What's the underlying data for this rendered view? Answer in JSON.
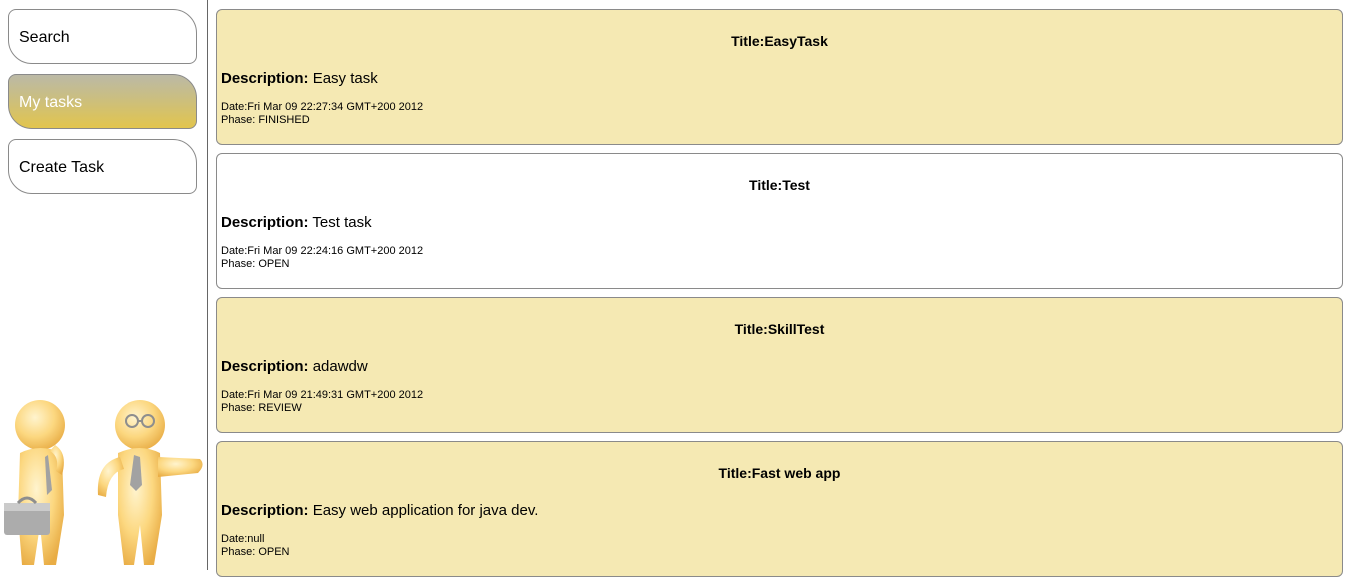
{
  "nav": {
    "search": "Search",
    "my_tasks": "My tasks",
    "create_task": "Create Task"
  },
  "labels": {
    "title_prefix": "Title:",
    "description": "Description:",
    "date_prefix": "Date:",
    "phase_prefix": "Phase: "
  },
  "tasks": [
    {
      "title": "EasyTask",
      "description": "Easy task",
      "date": "Fri Mar 09 22:27:34 GMT+200 2012",
      "phase": "FINISHED"
    },
    {
      "title": "Test",
      "description": "Test task",
      "date": "Fri Mar 09 22:24:16 GMT+200 2012",
      "phase": "OPEN"
    },
    {
      "title": "SkillTest",
      "description": "adawdw",
      "date": "Fri Mar 09 21:49:31 GMT+200 2012",
      "phase": "REVIEW"
    },
    {
      "title": "Fast web app",
      "description": "Easy web application for java dev.",
      "date": "null",
      "phase": "OPEN"
    }
  ],
  "colors": {
    "card_a": "#f5e9b3",
    "card_b": "#ffffff",
    "active_nav_bottom": "#e2c54d"
  }
}
